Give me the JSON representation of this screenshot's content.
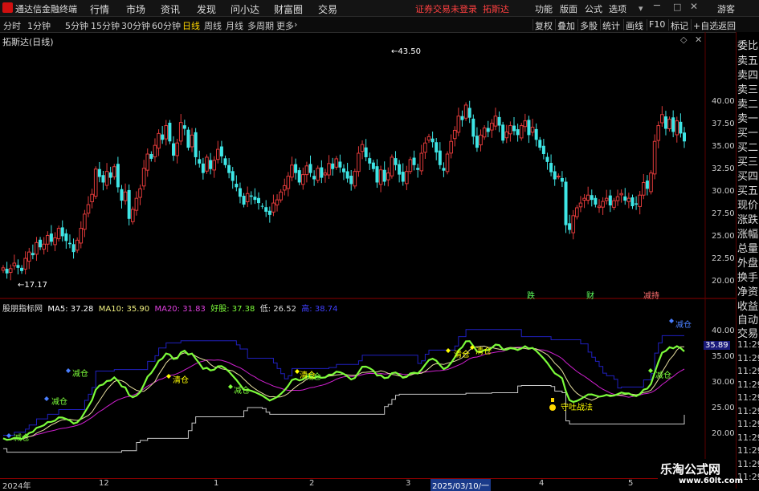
{
  "titlebar": {
    "app_title": "通达信金融终端",
    "menus": [
      "行情",
      "市场",
      "资讯",
      "发现",
      "问小达",
      "财富圈",
      "交易"
    ],
    "notice": "证券交易未登录",
    "stock_name": "拓斯达",
    "right_menus": [
      "功能",
      "版面",
      "公式",
      "选项"
    ],
    "login": "游客"
  },
  "toolbar": {
    "periods": [
      "分时",
      "1分钟",
      "5分钟",
      "15分钟",
      "30分钟",
      "60分钟",
      "日线",
      "周线",
      "月线",
      "多周期",
      "更多"
    ],
    "active_period": "日线",
    "buttons": [
      "复权",
      "叠加",
      "多股",
      "统计",
      "画线",
      "F10",
      "标记",
      "+自选",
      "返回"
    ]
  },
  "main_chart": {
    "header": "拓斯达(日线)",
    "high_marker": "43.50",
    "low_marker": "17.17",
    "y_ticks": [
      "40.00",
      "37.50",
      "35.00",
      "32.50",
      "30.00",
      "27.50",
      "25.00",
      "22.50",
      "20.00"
    ],
    "event_badges": [
      "跌",
      "财",
      "减持"
    ]
  },
  "right_panel": {
    "labels": [
      "委比",
      "卖五",
      "卖四",
      "卖三",
      "卖二",
      "卖一",
      "买一",
      "买二",
      "买三",
      "买四",
      "买五",
      "现价",
      "涨跌",
      "涨幅",
      "总量",
      "外盘",
      "换手",
      "净资",
      "收益",
      "自动",
      "交易"
    ]
  },
  "indicator": {
    "name": "股朋指标网",
    "ma5_label": "MA5: 37.28",
    "ma10_label": "MA10: 35.90",
    "ma20_label": "MA20: 31.83",
    "good_label": "好股: 37.38",
    "low_label": "低: 26.52",
    "high_label": "高: 38.74",
    "y_ticks": [
      "40.00",
      "35.00",
      "30.00",
      "25.00",
      "20.00"
    ],
    "current_value": "35.89",
    "signal_labels": [
      "减仓",
      "减仓",
      "减仓",
      "减仓",
      "清仓",
      "减仓",
      "清仓",
      "清仓",
      "清仓",
      "守吐战法",
      "减仓",
      "减仓"
    ],
    "right_times": [
      "11:29",
      "11:29",
      "11:29",
      "11:29",
      "11:29",
      "11:29",
      "11:29",
      "11:29",
      "11:29",
      "11:29",
      "11:29",
      "11:29",
      "11:29"
    ]
  },
  "date_axis": {
    "labels": [
      "2024年",
      "12",
      "1",
      "2",
      "3",
      "2025/03/10/一",
      "4",
      "5"
    ]
  },
  "watermark": {
    "title": "乐淘公式网",
    "url": "www.60lt.com"
  },
  "colors": {
    "up": "#e03a3a",
    "down": "#3ee6e6",
    "ma5": "#7cfc3a",
    "ma10": "#e8e0a0",
    "ma20": "#d020d0",
    "upper": "#2020c0",
    "lower": "#c8c8c8",
    "signal": "#ffff00"
  }
}
